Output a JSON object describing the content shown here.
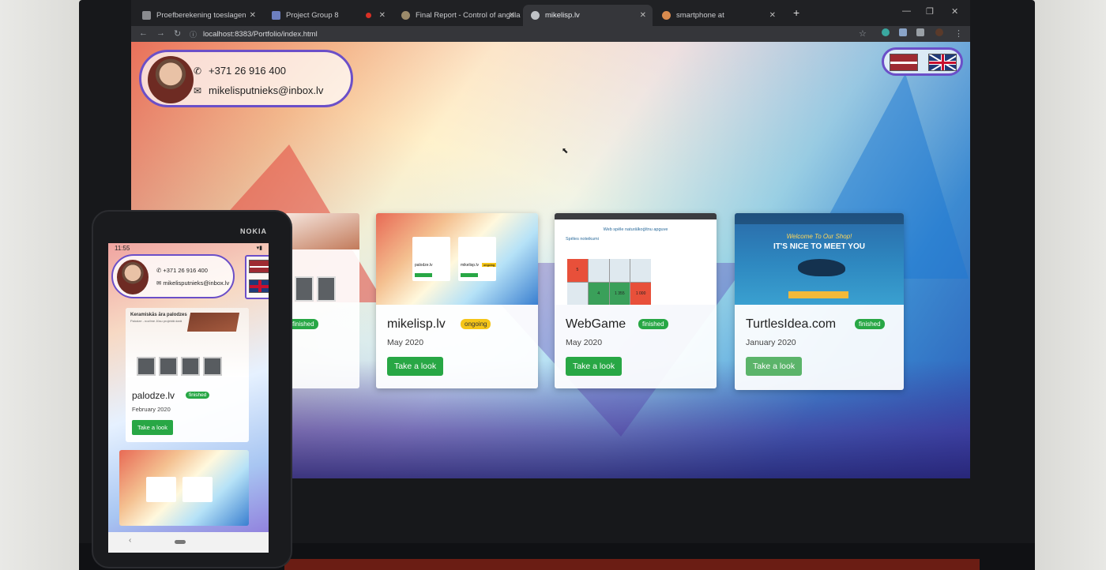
{
  "browser": {
    "tabs": [
      {
        "label": "Proefberekening toeslagen"
      },
      {
        "label": "Project Group 8"
      },
      {
        "label": "Final Report - Control of angula"
      },
      {
        "label": "mikelisp.lv"
      },
      {
        "label": "smartphone at"
      }
    ],
    "url": "localhost:8383/Portfolio/index.html"
  },
  "page": {
    "contact": {
      "phone": "+371 26 916 400",
      "email": "mikelisputnieks@inbox.lv"
    },
    "projects": [
      {
        "title": "mikelisp.lv",
        "status": "ongoing",
        "date": "May 2020",
        "button": "Take a look"
      },
      {
        "title": "WebGame",
        "status": "finished",
        "date": "May 2020",
        "button": "Take a look"
      },
      {
        "title": "TurtlesIdea.com",
        "status": "finished",
        "date": "January 2020",
        "button": "Take a look"
      }
    ],
    "left_partial_badge": "finished",
    "thumb_mikelisp": {
      "left_title": "palodze.lv",
      "right_title": "mikelisp.lv",
      "right_badge": "ongoing"
    },
    "thumb_webgame": {
      "heading": "Web spēle naturālkoģītnu apguve",
      "subheading": "Spēles noteikumi",
      "cells": [
        "5",
        "",
        "",
        "",
        "",
        "4",
        "1 355",
        "1 000"
      ]
    },
    "thumb_turtles": {
      "welcome": "Welcome To Our Shop!",
      "headline": "IT'S NICE TO MEET YOU"
    }
  },
  "phone": {
    "brand": "NOKIA",
    "time": "11:55",
    "contact": {
      "phone": "+371 26 916 400",
      "email": "mikelisputnieks@inbox.lv"
    },
    "card": {
      "thumb_heading": "Keramiskās āra palodzes",
      "thumb_sub": "Palodze - nozīme Jūsu projektā darā",
      "title": "palodze.lv",
      "status": "finished",
      "date": "February 2020",
      "button": "Take a look"
    }
  },
  "colors": {
    "accent_border": "#6b4fc8",
    "success": "#28a745",
    "warning": "#f5c518"
  }
}
